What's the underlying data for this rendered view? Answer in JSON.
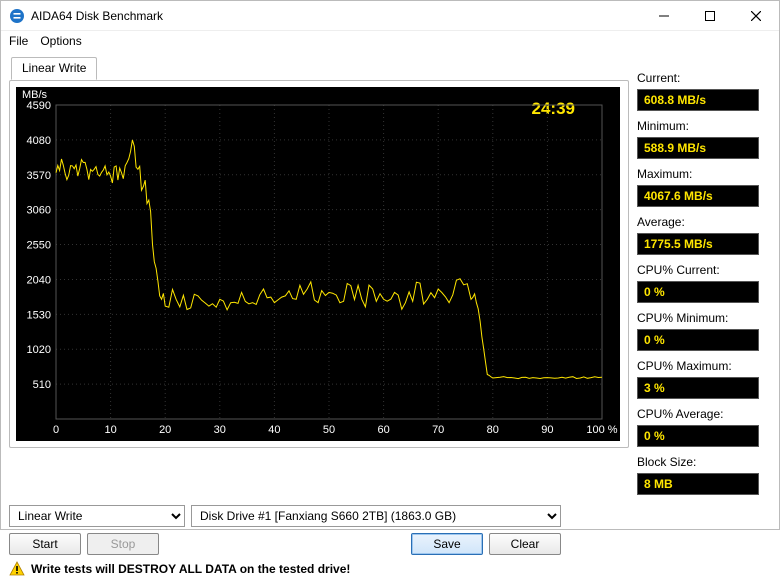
{
  "window": {
    "title": "AIDA64 Disk Benchmark"
  },
  "menu": {
    "file": "File",
    "options": "Options"
  },
  "tab": {
    "label": "Linear Write"
  },
  "chart": {
    "unit_label": "MB/s",
    "elapsed_time": "24:39"
  },
  "stats": {
    "current_label": "Current:",
    "current_value": "608.8 MB/s",
    "minimum_label": "Minimum:",
    "minimum_value": "588.9 MB/s",
    "maximum_label": "Maximum:",
    "maximum_value": "4067.6 MB/s",
    "average_label": "Average:",
    "average_value": "1775.5 MB/s",
    "cpu_current_label": "CPU% Current:",
    "cpu_current_value": "0 %",
    "cpu_minimum_label": "CPU% Minimum:",
    "cpu_minimum_value": "0 %",
    "cpu_maximum_label": "CPU% Maximum:",
    "cpu_maximum_value": "3 %",
    "cpu_average_label": "CPU% Average:",
    "cpu_average_value": "0 %",
    "block_size_label": "Block Size:",
    "block_size_value": "8 MB"
  },
  "controls": {
    "test_select": "Linear Write",
    "drive_select": "Disk Drive #1  [Fanxiang S660 2TB]  (1863.0 GB)",
    "start": "Start",
    "stop": "Stop",
    "save": "Save",
    "clear": "Clear"
  },
  "warning": {
    "text": "Write tests will DESTROY ALL DATA on the tested drive!"
  },
  "chart_data": {
    "type": "line",
    "xlabel": "%",
    "ylabel": "MB/s",
    "xlim": [
      0,
      100
    ],
    "ylim": [
      0,
      4590
    ],
    "x_ticks": [
      0,
      10,
      20,
      30,
      40,
      50,
      60,
      70,
      80,
      90,
      100
    ],
    "y_ticks": [
      510,
      1020,
      1530,
      2040,
      2550,
      3060,
      3570,
      4080,
      4590
    ],
    "series": [
      {
        "name": "Linear Write MB/s",
        "color": "#ffe600",
        "x": [
          0,
          1,
          2,
          3,
          4,
          5,
          6,
          7,
          8,
          9,
          10,
          11,
          12,
          13,
          14,
          15,
          16,
          17,
          18,
          19,
          20,
          22,
          24,
          26,
          28,
          30,
          32,
          34,
          36,
          38,
          40,
          42,
          44,
          46,
          48,
          50,
          52,
          54,
          56,
          58,
          60,
          62,
          64,
          66,
          68,
          70,
          72,
          74,
          76,
          77,
          78,
          79,
          80,
          82,
          84,
          86,
          88,
          90,
          92,
          94,
          96,
          98,
          100
        ],
        "values": [
          3600,
          3800,
          3500,
          3700,
          3550,
          3750,
          3500,
          3650,
          3550,
          3700,
          3550,
          3700,
          3600,
          3750,
          4080,
          3650,
          3400,
          3200,
          2300,
          1800,
          1650,
          1750,
          1600,
          1800,
          1650,
          1750,
          1700,
          1850,
          1700,
          1900,
          1700,
          1800,
          1750,
          1900,
          1700,
          1850,
          1700,
          1950,
          1750,
          1900,
          1750,
          1850,
          1700,
          2000,
          1750,
          1900,
          1700,
          2050,
          1750,
          1700,
          1200,
          650,
          600,
          620,
          600,
          610,
          600,
          605,
          600,
          610,
          600,
          605,
          609
        ]
      }
    ]
  }
}
